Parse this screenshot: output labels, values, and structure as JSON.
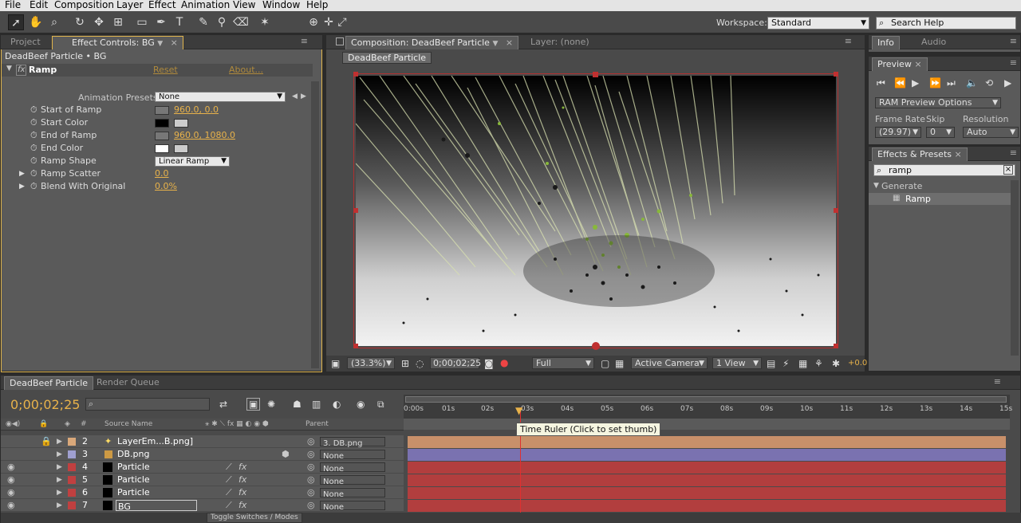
{
  "menu": [
    "File",
    "Edit",
    "Composition",
    "Layer",
    "Effect",
    "Animation",
    "View",
    "Window",
    "Help"
  ],
  "toolbar": {
    "workspace_label": "Workspace:",
    "workspace_value": "Standard",
    "search_help_placeholder": "Search Help"
  },
  "left_panel": {
    "tabs": [
      "Project",
      "Effect Controls: BG"
    ],
    "header": "DeadBeef Particle • BG",
    "effect_name": "Ramp",
    "reset": "Reset",
    "about": "About...",
    "presets_label": "Animation Presets:",
    "presets_value": "None",
    "props": {
      "start_of_ramp": "Start of Ramp",
      "start_of_ramp_val": "960.0, 0.0",
      "start_color": "Start Color",
      "end_of_ramp": "End of Ramp",
      "end_of_ramp_val": "960.0, 1080.0",
      "end_color": "End Color",
      "ramp_shape": "Ramp Shape",
      "ramp_shape_val": "Linear Ramp",
      "ramp_scatter": "Ramp Scatter",
      "ramp_scatter_val": "0.0",
      "blend": "Blend With Original",
      "blend_val": "0.0%"
    }
  },
  "comp_panel": {
    "tab_comp": "Composition: DeadBeef Particle",
    "tab_layer": "Layer: (none)",
    "crumb": "DeadBeef Particle",
    "zoom": "(33.3%)",
    "timecode": "0;00;02;25",
    "quality": "Full",
    "camera": "Active Camera",
    "view": "1 View",
    "exposure": "+0.0"
  },
  "right_panel": {
    "info_tab": "Info",
    "audio_tab": "Audio",
    "preview_tab": "Preview",
    "ram_preview": "RAM Preview Options",
    "frame_rate_label": "Frame Rate",
    "skip_label": "Skip",
    "resolution_label": "Resolution",
    "frame_rate_val": "(29.97)",
    "skip_val": "0",
    "resolution_val": "Auto",
    "effects_tab": "Effects & Presets",
    "search_value": "ramp",
    "generate": "Generate",
    "ramp_item": "Ramp"
  },
  "timeline": {
    "tabs": [
      "DeadBeef Particle",
      "Render Queue"
    ],
    "timecode": "0;00;02;25",
    "col_num": "#",
    "col_source": "Source Name",
    "col_parent": "Parent",
    "ruler": [
      "0:00s",
      "01s",
      "02s",
      "03s",
      "04s",
      "05s",
      "06s",
      "07s",
      "08s",
      "09s",
      "10s",
      "11s",
      "12s",
      "13s",
      "14s",
      "15s"
    ],
    "tooltip": "Time Ruler (Click to set thumb)",
    "toggle": "Toggle Switches / Modes",
    "layers": [
      {
        "num": "2",
        "name": "LayerEm...B.png]",
        "parent": "3. DB.png",
        "label": "#d9a87a",
        "bar": "#c8906a"
      },
      {
        "num": "3",
        "name": "DB.png",
        "parent": "None",
        "label": "#a0a0d0",
        "bar": "#7a72b0"
      },
      {
        "num": "4",
        "name": "Particle",
        "parent": "None",
        "label": "#c04040",
        "bar": "#b23e3e"
      },
      {
        "num": "5",
        "name": "Particle",
        "parent": "None",
        "label": "#c04040",
        "bar": "#b23e3e"
      },
      {
        "num": "6",
        "name": "Particle",
        "parent": "None",
        "label": "#c04040",
        "bar": "#b23e3e"
      },
      {
        "num": "7",
        "name": "BG",
        "parent": "None",
        "label": "#c04040",
        "bar": "#b23e3e"
      }
    ]
  },
  "colors": {
    "accent": "#e8b24a",
    "bar_red": "#b23e3e",
    "bar_orange": "#c8906a",
    "bar_purple": "#7a72b0"
  }
}
